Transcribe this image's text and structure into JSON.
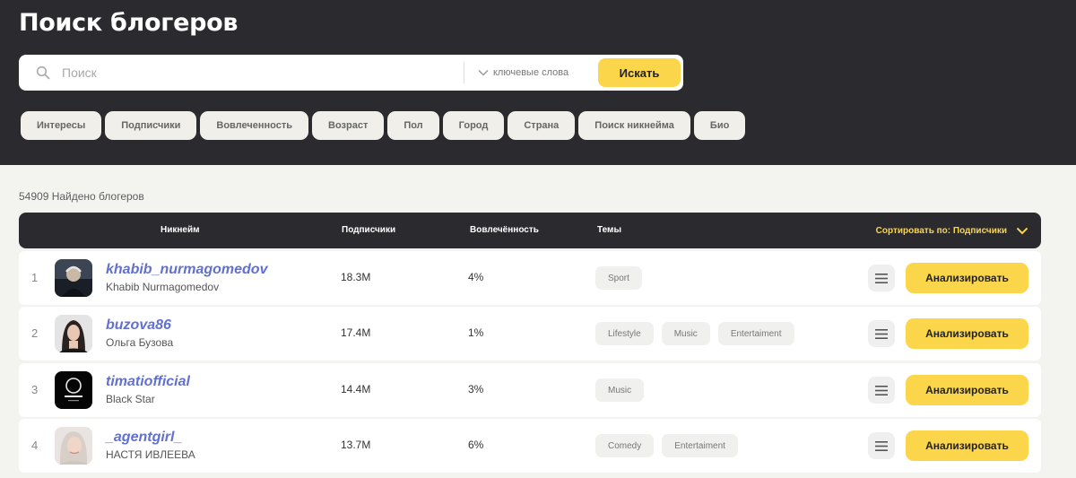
{
  "header": {
    "title": "Поиск блогеров"
  },
  "search": {
    "placeholder": "Поиск",
    "value": "",
    "mode_label": "ключевые слова",
    "button_label": "Искать"
  },
  "filters": [
    "Интересы",
    "Подписчики",
    "Вовлеченность",
    "Возраст",
    "Пол",
    "Город",
    "Страна",
    "Поиск никнейма",
    "Био"
  ],
  "results": {
    "count_text": "54909 Найдено блогеров"
  },
  "table": {
    "columns": {
      "nickname": "Никнейм",
      "subscribers": "Подписчики",
      "engagement": "Вовлечённость",
      "topics": "Темы"
    },
    "sort_label": "Сортировать по: Подписчики",
    "analyze_label": "Анализировать",
    "rows": [
      {
        "rank": "1",
        "nick": "khabib_nurmagomedov",
        "name": "Khabib Nurmagomedov",
        "subs": "18.3M",
        "eng": "4%",
        "topics": [
          "Sport"
        ]
      },
      {
        "rank": "2",
        "nick": "buzova86",
        "name": "Ольга Бузова",
        "subs": "17.4M",
        "eng": "1%",
        "topics": [
          "Lifestyle",
          "Music",
          "Entertaiment"
        ]
      },
      {
        "rank": "3",
        "nick": "timatiofficial",
        "name": "Black Star",
        "subs": "14.4M",
        "eng": "3%",
        "topics": [
          "Music"
        ]
      },
      {
        "rank": "4",
        "nick": "_agentgirl_",
        "name": "НАСТЯ ИВЛЕЕВА",
        "subs": "13.7M",
        "eng": "6%",
        "topics": [
          "Comedy",
          "Entertaiment"
        ]
      }
    ]
  },
  "colors": {
    "dark": "#2b2a2f",
    "accent": "#fbd64b",
    "link": "#6270cf",
    "background": "#f3f3ef"
  }
}
